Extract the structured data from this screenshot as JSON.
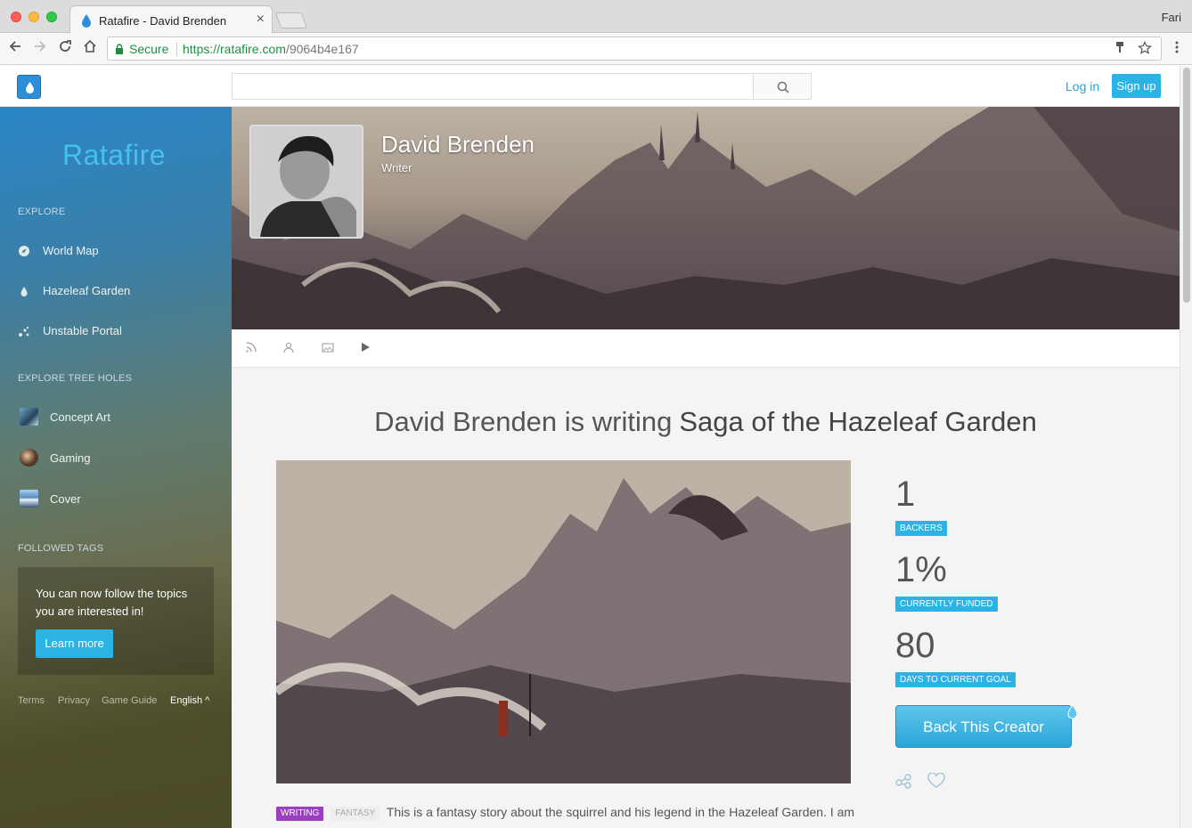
{
  "browser": {
    "tab_title": "Ratafire - David Brenden",
    "close_glyph": "×",
    "user": "Fari",
    "secure_label": "Secure",
    "url_host": "https://ratafire.com",
    "url_path": "/9064b4e167"
  },
  "header": {
    "search_placeholder": "",
    "login_label": "Log in",
    "signup_label": "Sign up"
  },
  "sidebar": {
    "brand": "Ratafire",
    "explore_title": "EXPLORE",
    "explore_items": [
      {
        "label": "World Map",
        "icon": "compass-icon"
      },
      {
        "label": "Hazeleaf Garden",
        "icon": "drop-icon"
      },
      {
        "label": "Unstable Portal",
        "icon": "portal-icon"
      }
    ],
    "tree_holes_title": "EXPLORE TREE HOLES",
    "tree_holes": [
      {
        "label": "Concept Art"
      },
      {
        "label": "Gaming"
      },
      {
        "label": "Cover"
      }
    ],
    "followed_tags_title": "FOLLOWED TAGS",
    "tags_card": {
      "text": "You can now follow the topics you are interested in!",
      "button": "Learn more"
    },
    "footer": {
      "terms": "Terms",
      "privacy": "Privacy",
      "guide": "Game Guide",
      "language": "English ^"
    }
  },
  "profile": {
    "name": "David Brenden",
    "role": "Writer"
  },
  "project": {
    "headline_prefix": "David Brenden is writing",
    "headline_title": "Saga of the Hazeleaf Garden",
    "stats": [
      {
        "value": "1",
        "label": "BACKERS"
      },
      {
        "value": "1%",
        "label": "CURRENTLY FUNDED"
      },
      {
        "value": "80",
        "label": "DAYS TO CURRENT GOAL"
      }
    ],
    "back_button": "Back This Creator",
    "tag_writing": "WRITING",
    "tag_fantasy": "FANTASY",
    "description": "This is a fantasy story about the squirrel and his legend in the Hazeleaf Garden. I am"
  },
  "colors": {
    "accent": "#2ab3e4",
    "writing_badge": "#9b3fc0",
    "brand_text": "#44c1ef"
  }
}
